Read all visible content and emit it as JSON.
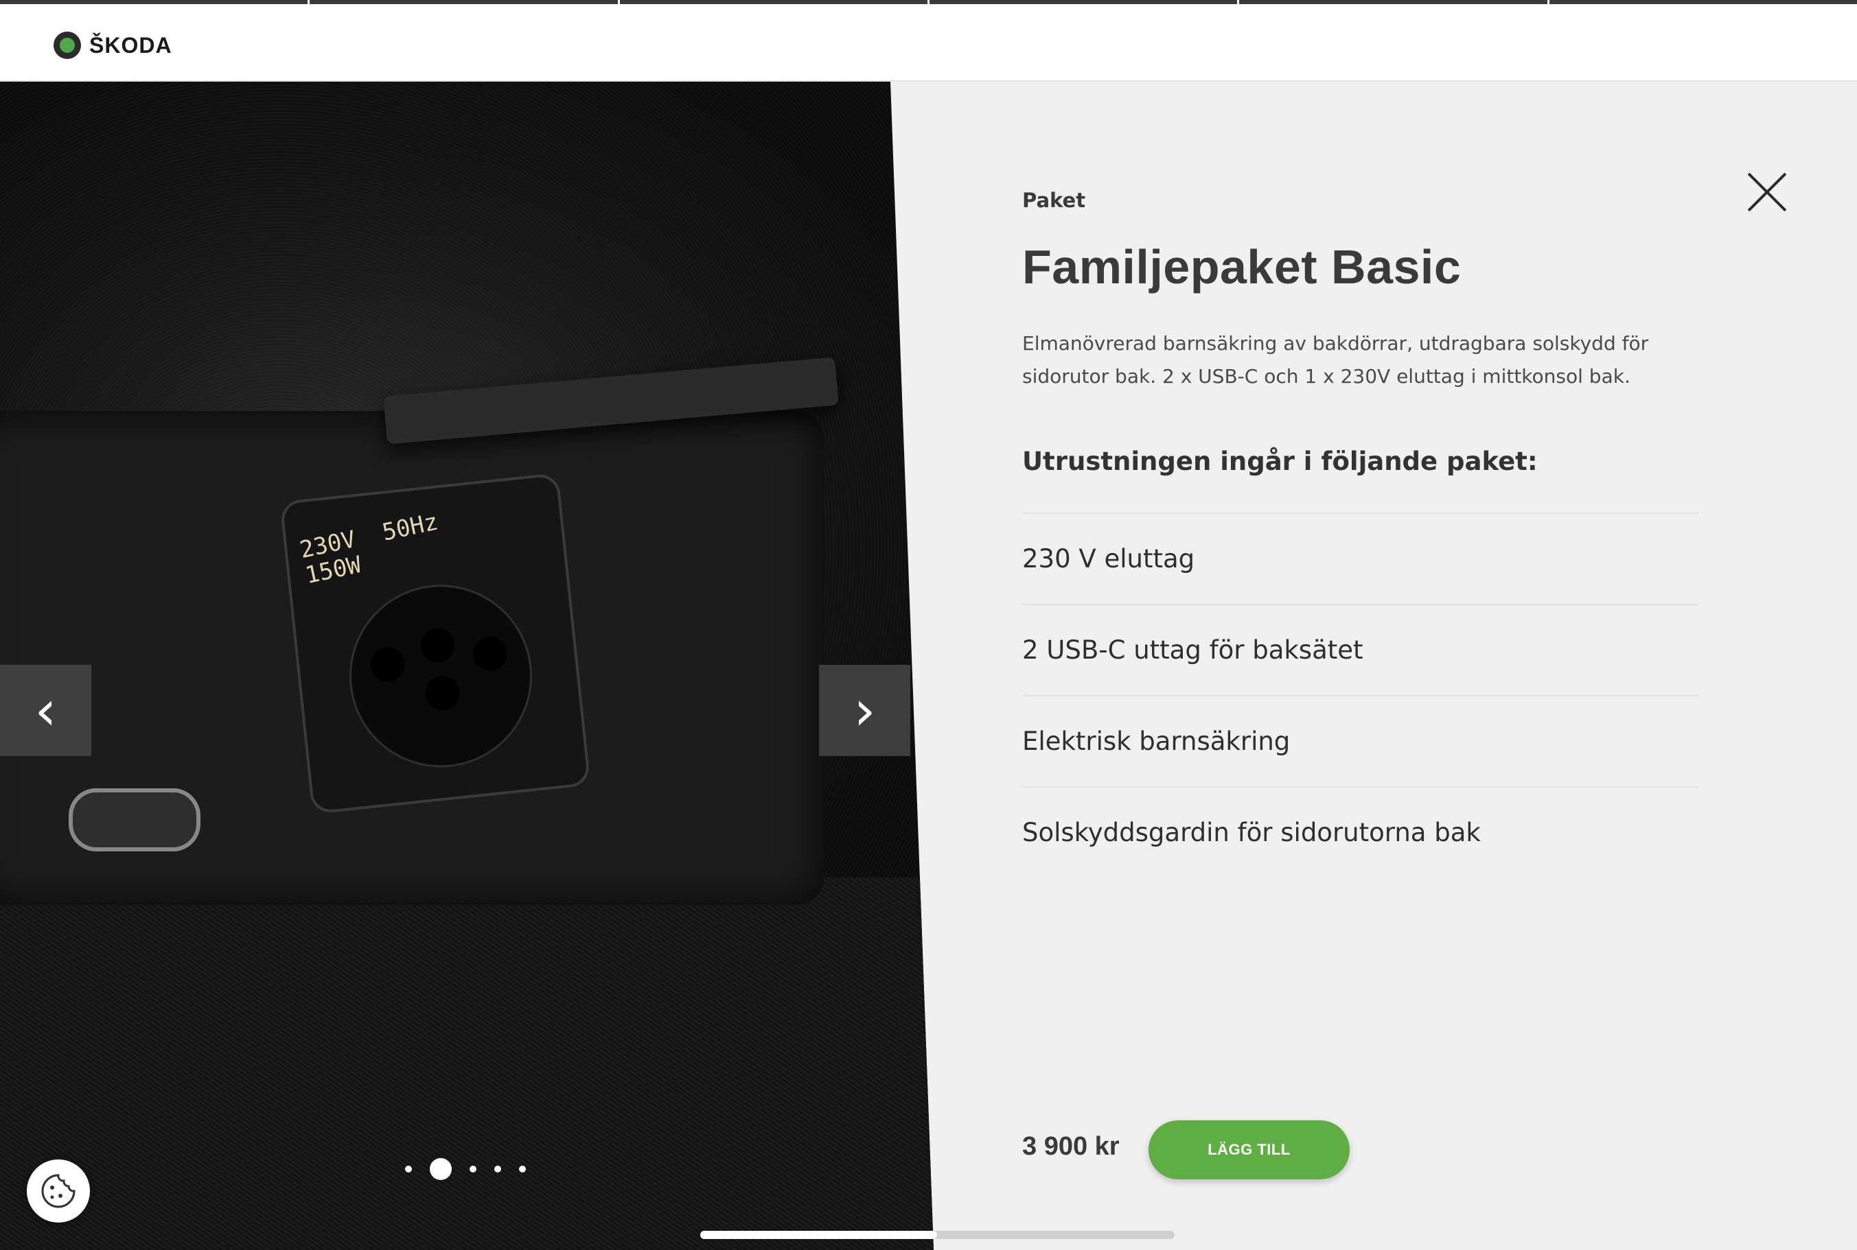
{
  "header": {
    "brand": "ŠKODA",
    "progress_segments": 6
  },
  "gallery": {
    "image_alt": "230V eluttag och USB-C i mittkonsol bak",
    "socket_label": "230V  50Hz\n150W",
    "prev_icon": "chevron-left-icon",
    "next_icon": "chevron-right-icon",
    "dots": 5,
    "active_dot": 1
  },
  "detail": {
    "category": "Paket",
    "title": "Familjepaket Basic",
    "description": "Elmanövrerad barnsäkring av bakdörrar, utdragbara solskydd för sidorutor bak. 2 x USB-C och 1 x 230V eluttag i mittkonsol bak.",
    "included_heading": "Utrustningen ingår i följande paket:",
    "included_items": [
      "230 V eluttag",
      "2 USB-C uttag för baksätet",
      "Elektrisk barnsäkring",
      "Solskyddsgardin för sidorutorna bak"
    ],
    "close_icon": "close-icon"
  },
  "footer": {
    "price": "3 900 kr",
    "add_label": "LÄGG TILL",
    "cookie_icon": "cookie-icon"
  },
  "colors": {
    "accent": "#5fae43",
    "panel_bg": "#f0f0f0",
    "text": "#3a3a3a"
  }
}
